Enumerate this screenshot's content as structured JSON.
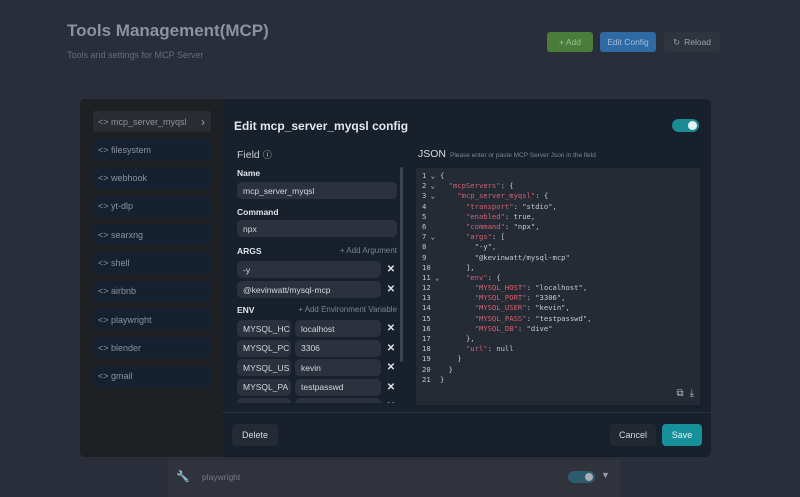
{
  "header": {
    "title": "Tools Management(MCP)",
    "subtitle": "Tools and settings for MCP Server",
    "add_label": "+ Add",
    "edit_label": "Edit Config",
    "reload_label": "Reload"
  },
  "sidebar": {
    "items": [
      "mcp_server_myqsl",
      "filesystem",
      "webhook",
      "yt-dlp",
      "searxng",
      "shell",
      "airbnb",
      "playwright",
      "blender",
      "gmail"
    ],
    "prefix": "<>"
  },
  "modal": {
    "title": "Edit mcp_server_myqsl config",
    "enabled": true,
    "field": {
      "heading": "Field",
      "name_label": "Name",
      "name_value": "mcp_server_myqsl",
      "command_label": "Command",
      "command_value": "npx",
      "args_label": "ARGS",
      "add_arg": "+ Add Argument",
      "args": [
        "-y",
        "@kevinwatt/mysql-mcp"
      ],
      "env_label": "ENV",
      "add_env": "+ Add Environment Variable",
      "env": [
        {
          "key": "MYSQL_HC",
          "value": "localhost"
        },
        {
          "key": "MYSQL_PC",
          "value": "3306"
        },
        {
          "key": "MYSQL_US",
          "value": "kevin"
        },
        {
          "key": "MYSQL_PA",
          "value": "testpasswd"
        },
        {
          "key": "MYSQL_DB",
          "value": "dive"
        }
      ]
    },
    "json": {
      "heading": "JSON",
      "hint": "Please enter or paste MCP Server Json in the field",
      "lines": [
        "{",
        "  \"mcpServers\": {",
        "    \"mcp_server_myqsl\": {",
        "      \"transport\": \"stdio\",",
        "      \"enabled\": true,",
        "      \"command\": \"npx\",",
        "      \"args\": [",
        "        \"-y\",",
        "        \"@kevinwatt/mysql-mcp\"",
        "      ],",
        "      \"env\": {",
        "        \"MYSQL_HOST\": \"localhost\",",
        "        \"MYSQL_PORT\": \"3306\",",
        "        \"MYSQL_USER\": \"kevin\",",
        "        \"MYSQL_PASS\": \"testpasswd\",",
        "        \"MYSQL_DB\": \"dive\"",
        "      },",
        "      \"url\": null",
        "    }",
        "  }",
        "}"
      ]
    },
    "delete_label": "Delete",
    "cancel_label": "Cancel",
    "save_label": "Save"
  },
  "background_item": {
    "name": "playwright",
    "enabled": true
  },
  "colors": {
    "accent": "#16909a",
    "add": "#4a7c3a",
    "edit": "#2f6aa5",
    "json_key": "#d2606f"
  }
}
